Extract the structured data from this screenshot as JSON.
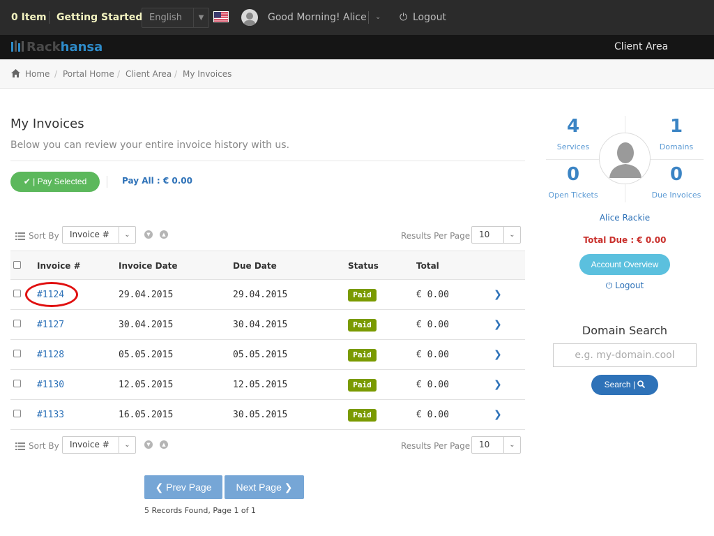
{
  "topbar": {
    "cart": "0 Item",
    "getting_started": "Getting Started",
    "language": "English",
    "greeting": "Good Morning! Alice",
    "logout": "Logout"
  },
  "brand": {
    "part1": "Rack",
    "part2": "hansa",
    "client_area": "Client Area"
  },
  "breadcrumb": [
    "Home",
    "Portal Home",
    "Client Area",
    "My Invoices"
  ],
  "page": {
    "title": "My Invoices",
    "subtitle": "Below you can review your entire invoice history with us.",
    "pay_selected": "Pay Selected",
    "pay_all": "Pay All : € 0.00"
  },
  "controls": {
    "sort_by": "Sort By",
    "sort_value": "Invoice #",
    "results_per_page": "Results Per Page",
    "rpp_value": "10"
  },
  "table": {
    "headers": [
      "Invoice #",
      "Invoice Date",
      "Due Date",
      "Status",
      "Total"
    ],
    "rows": [
      {
        "invoice": "#1124",
        "date": "29.04.2015",
        "due": "29.04.2015",
        "status": "Paid",
        "total": "€ 0.00"
      },
      {
        "invoice": "#1127",
        "date": "30.04.2015",
        "due": "30.04.2015",
        "status": "Paid",
        "total": "€ 0.00"
      },
      {
        "invoice": "#1128",
        "date": "05.05.2015",
        "due": "05.05.2015",
        "status": "Paid",
        "total": "€ 0.00"
      },
      {
        "invoice": "#1130",
        "date": "12.05.2015",
        "due": "12.05.2015",
        "status": "Paid",
        "total": "€ 0.00"
      },
      {
        "invoice": "#1133",
        "date": "16.05.2015",
        "due": "30.05.2015",
        "status": "Paid",
        "total": "€ 0.00"
      }
    ]
  },
  "pager": {
    "prev": "Prev Page",
    "next": "Next Page",
    "records": "5 Records Found, Page 1 of 1"
  },
  "sidebar": {
    "services_count": "4",
    "services_label": "Services",
    "domains_count": "1",
    "domains_label": "Domains",
    "tickets_count": "0",
    "tickets_label": "Open Tickets",
    "due_count": "0",
    "due_label": "Due Invoices",
    "user_name": "Alice Rackie",
    "total_due": "Total Due : € 0.00",
    "account_overview": "Account Overview",
    "logout": "Logout",
    "domain_search_title": "Domain Search",
    "domain_search_placeholder": "e.g. my-domain.cool",
    "search_button": "Search"
  },
  "colors": {
    "topbar_bg": "#2b2b2b",
    "brand_blue": "#2e8bc9",
    "link_blue": "#2e72b8",
    "paid_badge": "#7a9a01",
    "pay_green": "#5cb85c",
    "overview_cyan": "#5bc0de",
    "due_red": "#c9302c"
  }
}
